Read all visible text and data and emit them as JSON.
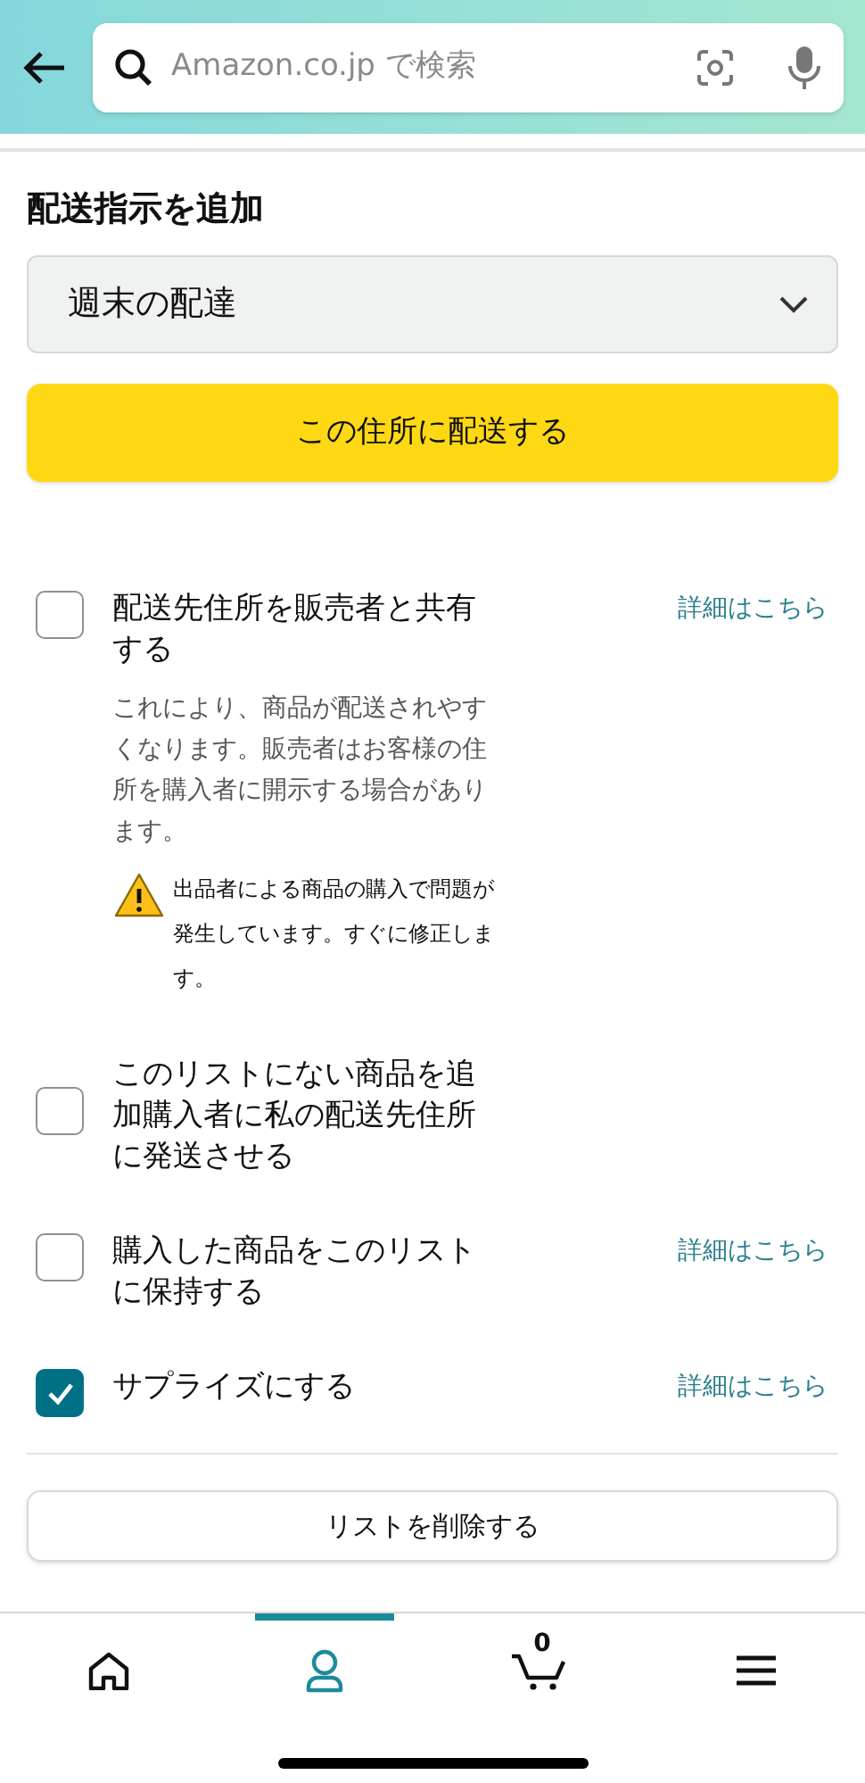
{
  "search": {
    "placeholder": "Amazon.co.jp で検索"
  },
  "section_title": "配送指示を追加",
  "dropdown": {
    "value": "週末の配達"
  },
  "ship_button": "この住所に配送する",
  "options": [
    {
      "label": "配送先住所を販売者と共有する",
      "checked": false,
      "link": "詳細はこちら",
      "description": "これにより、商品が配送されやすくなります。販売者はお客様の住所を購入者に開示する場合があります。",
      "warning": "出品者による商品の購入で問題が発生しています。すぐに修正します。"
    },
    {
      "label": "このリストにない商品を追加購入者に私の配送先住所に発送させる",
      "checked": false
    },
    {
      "label": "購入した商品をこのリストに保持する",
      "checked": false,
      "link": "詳細はこちら"
    },
    {
      "label": "サプライズにする",
      "checked": true,
      "link": "詳細はこちら"
    }
  ],
  "delete_button": "リストを削除する",
  "nav": [
    {
      "kind": "home",
      "selected": false
    },
    {
      "kind": "account",
      "selected": true
    },
    {
      "kind": "cart",
      "selected": false,
      "count": "0"
    },
    {
      "kind": "menu",
      "selected": false
    }
  ]
}
